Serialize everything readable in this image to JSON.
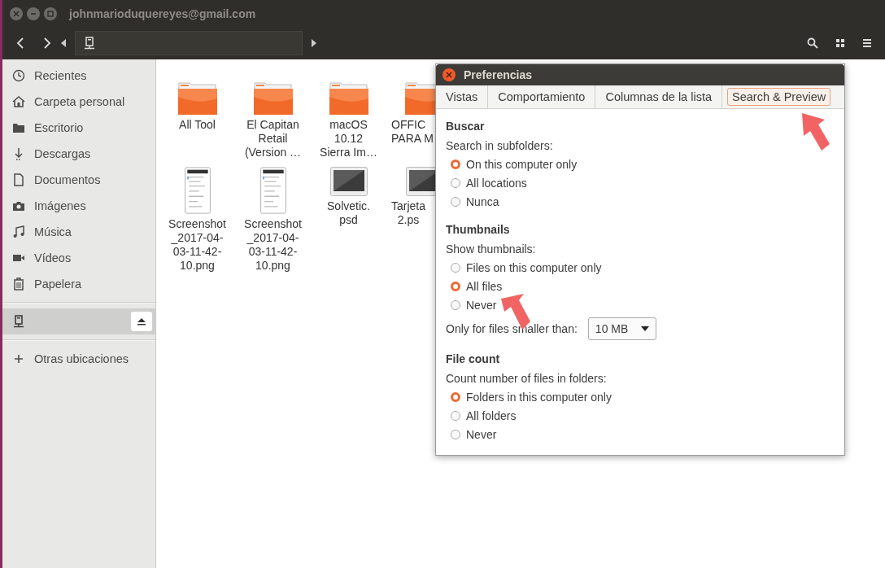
{
  "window": {
    "title": "johnmarioduquereyes@gmail.com"
  },
  "sidebar": {
    "places": [
      {
        "label": "Recientes",
        "kind": "recent",
        "selected": false
      },
      {
        "label": "Carpeta personal",
        "kind": "home",
        "selected": false
      },
      {
        "label": "Escritorio",
        "kind": "folder",
        "selected": false
      },
      {
        "label": "Descargas",
        "kind": "download",
        "selected": false
      },
      {
        "label": "Documentos",
        "kind": "document",
        "selected": false
      },
      {
        "label": "Imágenes",
        "kind": "camera",
        "selected": false
      },
      {
        "label": "Música",
        "kind": "music",
        "selected": false
      },
      {
        "label": "Vídeos",
        "kind": "video",
        "selected": false
      },
      {
        "label": "Papelera",
        "kind": "trash",
        "selected": false
      }
    ],
    "devices": [
      {
        "kind": "computer",
        "selected": true,
        "ejectable": true
      }
    ],
    "other": {
      "label": "Otras ubicaciones"
    }
  },
  "files": [
    {
      "name": "All Tool",
      "kind": "folder"
    },
    {
      "name": "El Capitan\nRetail\n(Version …",
      "kind": "folder"
    },
    {
      "name": "macOS\n10.12\nSierra Im…",
      "kind": "folder"
    },
    {
      "name": "OFFIC\nPARA M",
      "kind": "folder"
    },
    {
      "name": "Screenshot\n_2017-04-\n03-11-42-\n10.png",
      "kind": "document"
    },
    {
      "name": "Screenshot\n_2017-04-\n03-11-42-\n10.png",
      "kind": "document"
    },
    {
      "name": "Solvetic.\npsd",
      "kind": "image"
    },
    {
      "name": "Tarjeta\n  2.ps",
      "kind": "image"
    }
  ],
  "dialog": {
    "title": "Preferencias",
    "tabs": [
      {
        "label": "Vistas",
        "selected": false
      },
      {
        "label": "Comportamiento",
        "selected": false
      },
      {
        "label": "Columnas de la lista",
        "selected": false
      },
      {
        "label": "Search & Preview",
        "selected": true
      }
    ],
    "sections": [
      {
        "heading": "Buscar",
        "prompt": "Search in subfolders:",
        "options": [
          {
            "label": "On this computer only",
            "selected": true
          },
          {
            "label": "All locations",
            "selected": false
          },
          {
            "label": "Nunca",
            "selected": false
          }
        ]
      },
      {
        "heading": "Thumbnails",
        "prompt": "Show thumbnails:",
        "options": [
          {
            "label": "Files on this computer only",
            "selected": false
          },
          {
            "label": "All files",
            "selected": true
          },
          {
            "label": "Never",
            "selected": false
          }
        ],
        "size_limit": {
          "label": "Only for files smaller than:",
          "value": "10 MB"
        }
      },
      {
        "heading": "File count",
        "prompt": "Count number of files in folders:",
        "options": [
          {
            "label": "Folders in this computer only",
            "selected": true
          },
          {
            "label": "All folders",
            "selected": false
          },
          {
            "label": "Never",
            "selected": false
          }
        ]
      }
    ]
  }
}
